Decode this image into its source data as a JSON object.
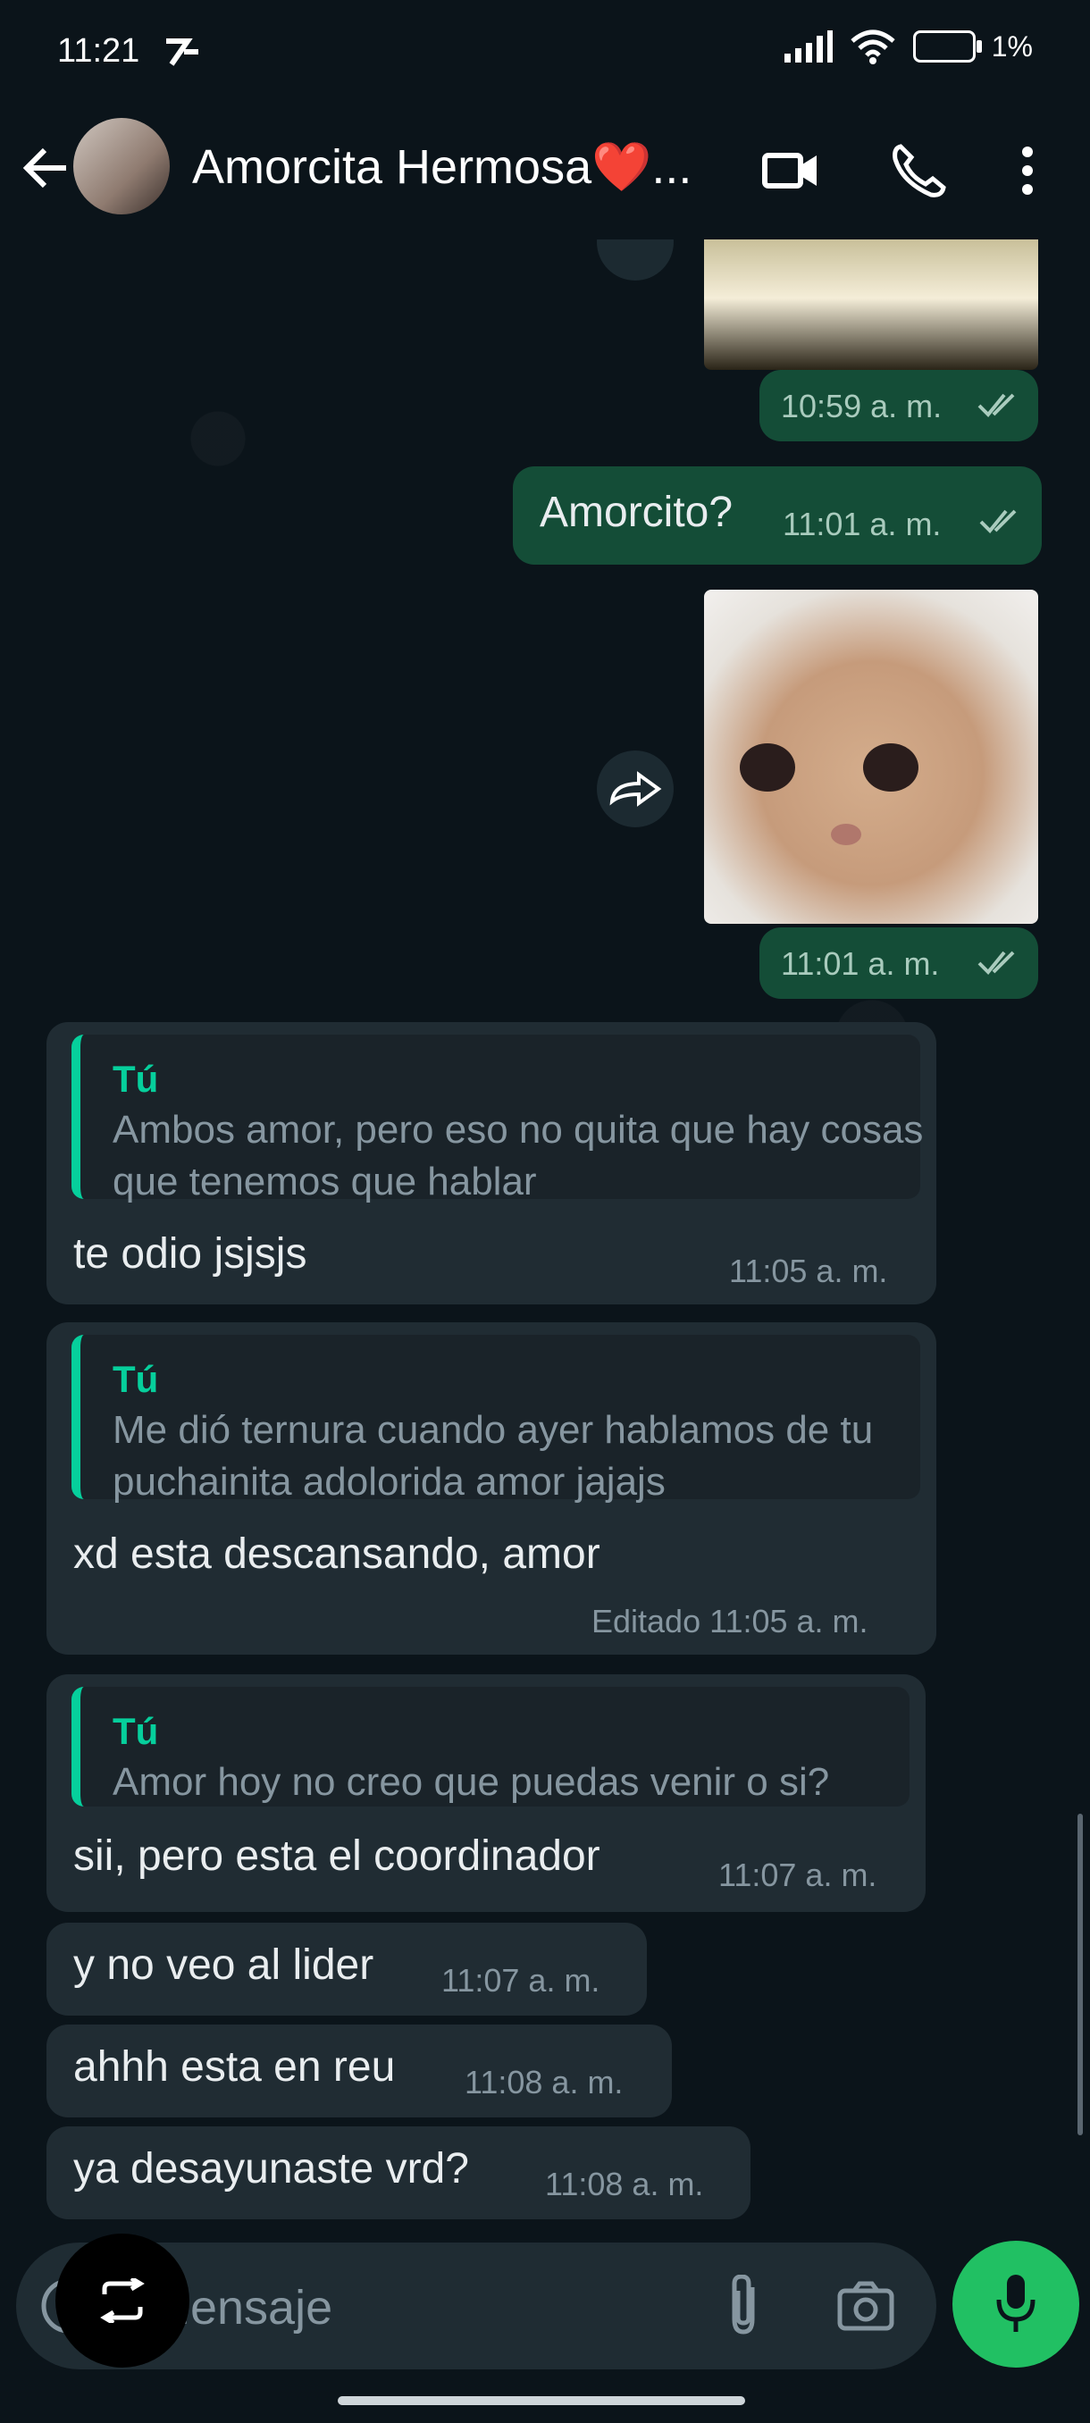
{
  "status": {
    "time": "11:21",
    "battery_text": "1%"
  },
  "header": {
    "title": "Amorcita Hermosa❤️..."
  },
  "messages": [
    {
      "time": "10:59 a. m."
    },
    {
      "text": "Amorcito?",
      "time": "11:01 a. m."
    },
    {
      "time": "11:01 a. m."
    },
    {
      "quote_name": "Tú",
      "quote_text": "Ambos amor, pero eso no quita que hay cosas que tenemos que hablar",
      "text": "te odio jsjsjs",
      "time": "11:05 a. m."
    },
    {
      "quote_name": "Tú",
      "quote_text": "Me dió ternura cuando ayer hablamos de tu puchainita adolorida amor jajajs",
      "text": "xd esta descansando, amor",
      "time": "Editado 11:05 a. m."
    },
    {
      "quote_name": "Tú",
      "quote_text": "Amor hoy no creo que puedas venir o si?",
      "text": "sii, pero esta el coordinador",
      "time": "11:07 a. m."
    },
    {
      "text": "y no veo al lider",
      "time": "11:07 a. m."
    },
    {
      "text": "ahhh esta en reu",
      "time": "11:08 a. m."
    },
    {
      "text": "ya desayunaste vrd?",
      "time": "11:08 a. m."
    }
  ],
  "input": {
    "placeholder": "Mensaje"
  },
  "colors": {
    "outgoing": "#144d37",
    "incoming": "#202c33",
    "accent": "#21c063"
  }
}
